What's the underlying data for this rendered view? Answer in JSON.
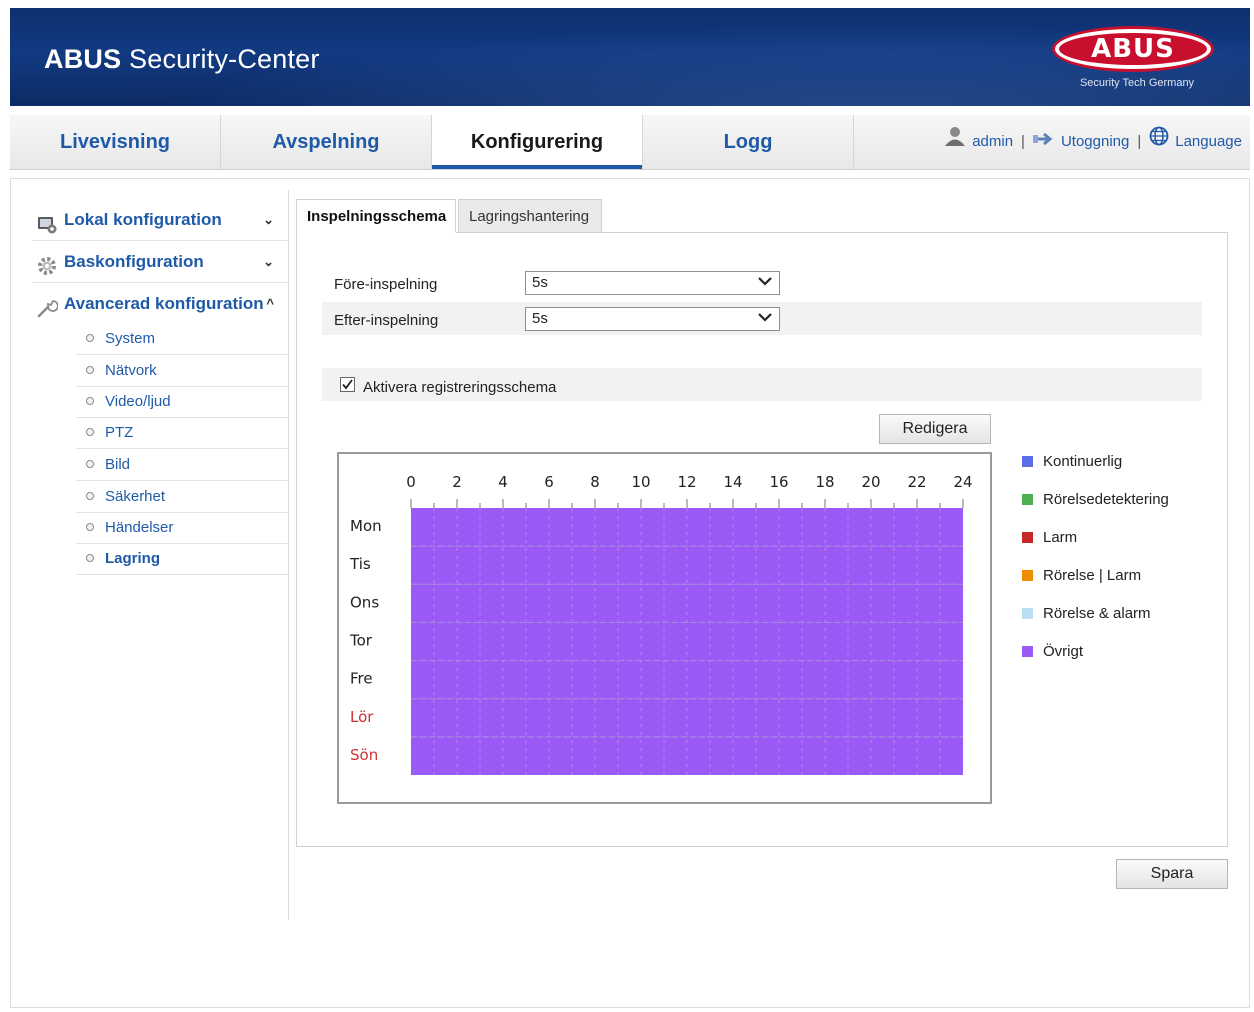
{
  "header": {
    "brand_bold": "ABUS",
    "brand_rest": " Security-Center",
    "logo_text": "ABUS",
    "logo_sub": "Security Tech Germany"
  },
  "nav": {
    "tabs": [
      {
        "label": "Livevisning"
      },
      {
        "label": "Avspelning"
      },
      {
        "label": "Konfigurering"
      },
      {
        "label": "Logg"
      }
    ],
    "active_tab": "Konfigurering",
    "user": "admin",
    "logout": "Utoggning",
    "language": "Language",
    "separator": "|"
  },
  "sidebar": {
    "sections": [
      {
        "label": "Lokal konfiguration",
        "icon": "monitor-settings-icon",
        "chevron": "⌄"
      },
      {
        "label": "Baskonfiguration",
        "icon": "gear-icon",
        "chevron": "⌄"
      },
      {
        "label": "Avancerad konfiguration",
        "icon": "wrench-icon",
        "chevron": "^"
      }
    ],
    "items": [
      {
        "label": "System"
      },
      {
        "label": "Nätvork"
      },
      {
        "label": "Video/ljud"
      },
      {
        "label": "PTZ"
      },
      {
        "label": "Bild"
      },
      {
        "label": "Säkerhet"
      },
      {
        "label": "Händelser"
      },
      {
        "label": "Lagring"
      }
    ],
    "active_item": "Lagring"
  },
  "content": {
    "tabs": [
      {
        "label": "Inspelningsschema"
      },
      {
        "label": "Lagringshantering"
      }
    ],
    "active_tab": "Inspelningsschema",
    "pre_record": {
      "label": "Före-inspelning",
      "value": "5s"
    },
    "post_record": {
      "label": "Efter-inspelning",
      "value": "5s"
    },
    "enable_schedule": {
      "label": "Aktivera registreringsschema",
      "checked": true
    },
    "edit_button": "Redigera",
    "save_button": "Spara"
  },
  "schedule": {
    "hours": [
      "0",
      "2",
      "4",
      "6",
      "8",
      "10",
      "12",
      "14",
      "16",
      "18",
      "20",
      "22",
      "24"
    ],
    "days": [
      {
        "label": "Mon",
        "weekend": false
      },
      {
        "label": "Tis",
        "weekend": false
      },
      {
        "label": "Ons",
        "weekend": false
      },
      {
        "label": "Tor",
        "weekend": false
      },
      {
        "label": "Fre",
        "weekend": false
      },
      {
        "label": "Lör",
        "weekend": true
      },
      {
        "label": "Sön",
        "weekend": true
      }
    ],
    "fill_type": "Övrigt",
    "coverage_hours": [
      0,
      24
    ],
    "fill_color": "#9b59f6",
    "weekend_color": "#d03030"
  },
  "legend": [
    {
      "label": "Kontinuerlig",
      "color": "#5b6ee8"
    },
    {
      "label": "Rörelsedetektering",
      "color": "#4caf50"
    },
    {
      "label": "Larm",
      "color": "#c62828"
    },
    {
      "label": "Rörelse | Larm",
      "color": "#f08c00"
    },
    {
      "label": "Rörelse & alarm",
      "color": "#b9dff5"
    },
    {
      "label": "Övrigt",
      "color": "#9b59f6"
    }
  ]
}
